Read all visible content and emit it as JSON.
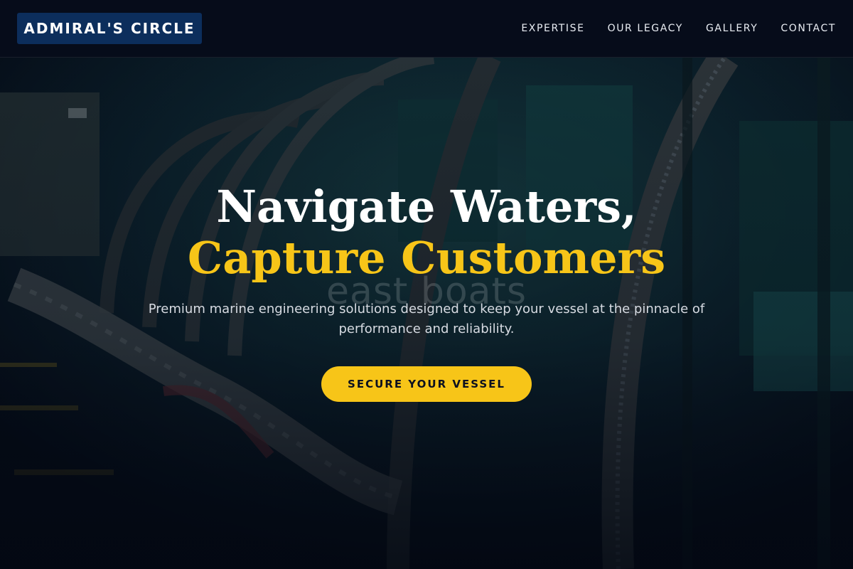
{
  "brand": {
    "name": "ADMIRAL'S CIRCLE",
    "logo_color": "#0c2e5c"
  },
  "nav": {
    "items": [
      {
        "label": "EXPERTISE"
      },
      {
        "label": "OUR LEGACY"
      },
      {
        "label": "GALLERY"
      },
      {
        "label": "CONTACT"
      }
    ]
  },
  "hero": {
    "headline_line1": "Navigate Waters,",
    "headline_line2": "Capture Customers",
    "subtext": "Premium marine engineering solutions designed to keep your vessel at the pinnacle of performance and reliability.",
    "cta_label": "SECURE YOUR VESSEL",
    "watermark": "east boats",
    "background_image": "engine-room-pipes-photo"
  },
  "colors": {
    "accent": "#f7c518",
    "header_bg": "#060c1a",
    "text_light": "#ffffff"
  }
}
